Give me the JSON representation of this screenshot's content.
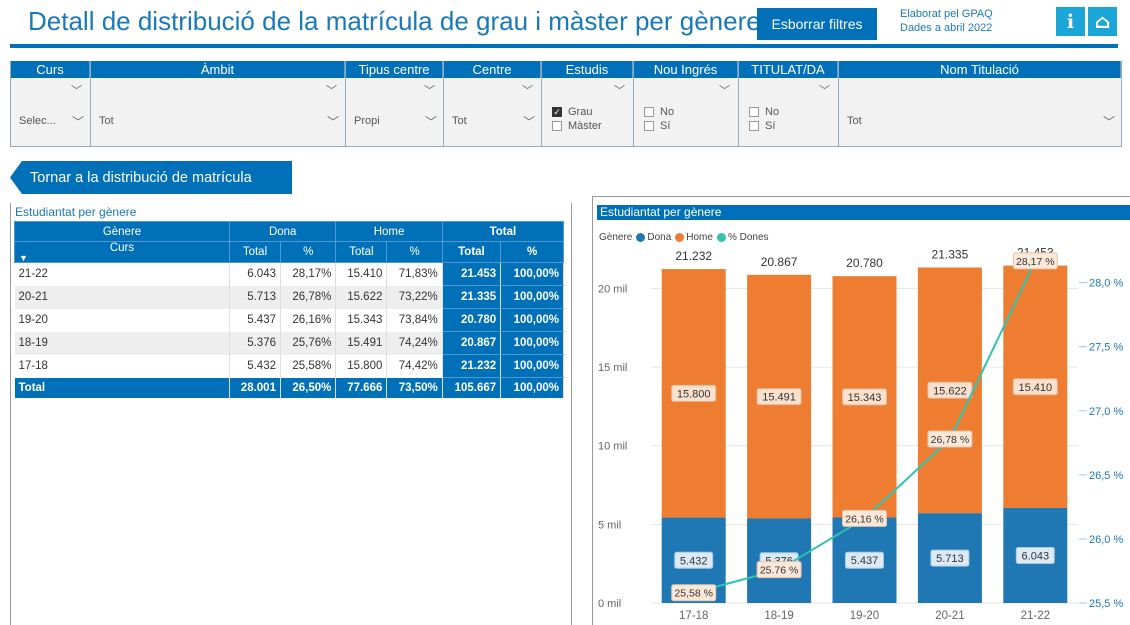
{
  "header": {
    "title": "Detall de distribució de la matrícula de grau i màster per gènere",
    "clear_filters": "Esborrar filtres",
    "credit_line1": "Elaborat pel GPAQ",
    "credit_line2": "Dades a abril 2022",
    "info_icon": "i",
    "home_icon": "⌂"
  },
  "filters": {
    "curs": {
      "label": "Curs",
      "value": "Selec..."
    },
    "ambit": {
      "label": "Àmbit",
      "value": "Tot"
    },
    "tipus_centre": {
      "label": "Tipus centre",
      "value": "Propi"
    },
    "centre": {
      "label": "Centre",
      "value": "Tot"
    },
    "estudis": {
      "label": "Estudis",
      "options": [
        {
          "label": "Grau",
          "checked": true
        },
        {
          "label": "Màster",
          "checked": false
        }
      ]
    },
    "nou_ingres": {
      "label": "Nou Ingrés",
      "options": [
        {
          "label": "No",
          "checked": false
        },
        {
          "label": "Sí",
          "checked": false
        }
      ]
    },
    "titulat": {
      "label": "TITULAT/DA",
      "options": [
        {
          "label": "No",
          "checked": false
        },
        {
          "label": "Sí",
          "checked": false
        }
      ]
    },
    "nom_titulacio": {
      "label": "Nom Titulació",
      "value": "Tot"
    }
  },
  "back_button": "Tornar a la distribució de matrícula",
  "matrix": {
    "title": "Estudiantat per gènere",
    "col_genere": "Gènere",
    "col_dona": "Dona",
    "col_home": "Home",
    "col_total": "Total",
    "col_curs": "Curs",
    "sub_total": "Total",
    "sub_pct": "%",
    "rows": [
      {
        "curs": "21-22",
        "dona": "6.043",
        "dona_pct": "28,17%",
        "home": "15.410",
        "home_pct": "71,83%",
        "total": "21.453",
        "total_pct": "100,00%"
      },
      {
        "curs": "20-21",
        "dona": "5.713",
        "dona_pct": "26,78%",
        "home": "15.622",
        "home_pct": "73,22%",
        "total": "21.335",
        "total_pct": "100,00%"
      },
      {
        "curs": "19-20",
        "dona": "5.437",
        "dona_pct": "26,16%",
        "home": "15.343",
        "home_pct": "73,84%",
        "total": "20.780",
        "total_pct": "100,00%"
      },
      {
        "curs": "18-19",
        "dona": "5.376",
        "dona_pct": "25,76%",
        "home": "15.491",
        "home_pct": "74,24%",
        "total": "20.867",
        "total_pct": "100,00%"
      },
      {
        "curs": "17-18",
        "dona": "5.432",
        "dona_pct": "25,58%",
        "home": "15.800",
        "home_pct": "74,42%",
        "total": "21.232",
        "total_pct": "100,00%"
      }
    ],
    "total_row": {
      "curs": "Total",
      "dona": "28.001",
      "dona_pct": "26,50%",
      "home": "77.666",
      "home_pct": "73,50%",
      "total": "105.667",
      "total_pct": "100,00%"
    }
  },
  "chart_panel": {
    "title": "Estudiantat per gènere",
    "legend_title": "Gènere",
    "legend": [
      "Dona",
      "Home",
      "% Dones"
    ]
  },
  "colors": {
    "dona": "#1f77b4",
    "home": "#ee7d31",
    "pct": "#2fc3b0",
    "brand": "#0070b8"
  },
  "chart_data": {
    "type": "bar",
    "stacked": true,
    "categories": [
      "17-18",
      "18-19",
      "19-20",
      "20-21",
      "21-22"
    ],
    "series": [
      {
        "name": "Dona",
        "values": [
          5432,
          5376,
          5437,
          5713,
          6043
        ],
        "labels": [
          "5.432",
          "5.376",
          "5.437",
          "5.713",
          "6.043"
        ]
      },
      {
        "name": "Home",
        "values": [
          15800,
          15491,
          15343,
          15622,
          15410
        ],
        "labels": [
          "15.800",
          "15.491",
          "15.343",
          "15.622",
          "15.410"
        ]
      }
    ],
    "totals": [
      21232,
      20867,
      20780,
      21335,
      21453
    ],
    "total_labels": [
      "21.232",
      "20.867",
      "20.780",
      "21.335",
      "21.453"
    ],
    "line": {
      "name": "% Dones",
      "values": [
        25.58,
        25.76,
        26.16,
        26.78,
        28.17
      ],
      "labels": [
        "25,58 %",
        "25.76 %",
        "26,16 %",
        "26,78 %",
        "28,17 %"
      ]
    },
    "y_left": {
      "range": [
        0,
        22000
      ],
      "ticks": [
        0,
        5000,
        10000,
        15000,
        20000
      ],
      "tick_labels": [
        "0 mil",
        "5 mil",
        "10 mil",
        "15 mil",
        "20 mil"
      ]
    },
    "y_right": {
      "range": [
        25.5,
        28.2
      ],
      "ticks": [
        25.5,
        26.0,
        26.5,
        27.0,
        27.5,
        28.0
      ],
      "tick_labels": [
        "25,5 %",
        "26,0 %",
        "26,5 %",
        "27,0 %",
        "27,5 %",
        "28,0 %"
      ]
    }
  }
}
